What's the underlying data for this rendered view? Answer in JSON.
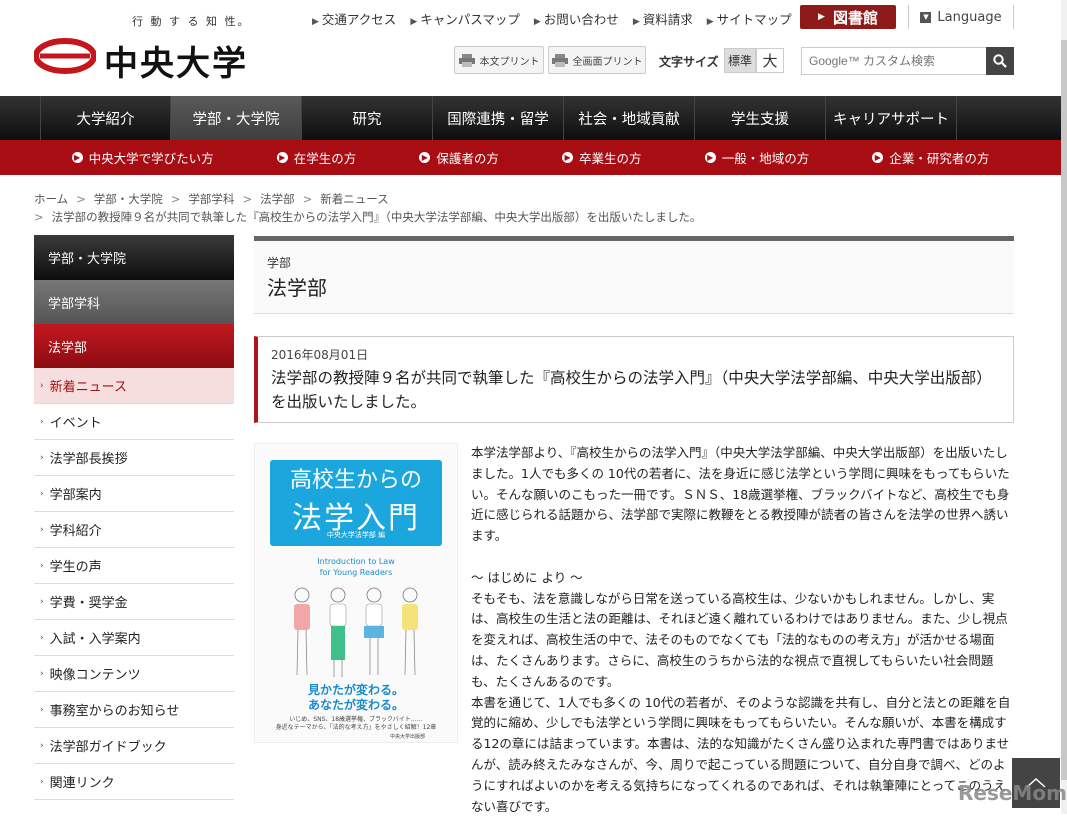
{
  "header": {
    "tagline": "行 動 す る 知 性。",
    "logo_text": "中央大学",
    "top_links": [
      "交通アクセス",
      "キャンパスマップ",
      "お問い合わせ",
      "資料請求",
      "サイトマップ"
    ],
    "library_label": "図書館",
    "language_label": "Language",
    "print_body_label": "本文プリント",
    "print_all_label": "全画面プリント",
    "font_size_label": "文字サイズ",
    "font_size_standard": "標準",
    "font_size_large": "大",
    "search_placeholder": "Google™ カスタム検索"
  },
  "main_nav": [
    "大学紹介",
    "学部・大学院",
    "研究",
    "国際連携・留学",
    "社会・地域貢献",
    "学生支援",
    "キャリアサポート"
  ],
  "main_nav_active": "学部・大学院",
  "sub_nav": [
    "中央大学で学びたい方",
    "在学生の方",
    "保護者の方",
    "卒業生の方",
    "一般・地域の方",
    "企業・研究者の方"
  ],
  "breadcrumb": {
    "items": [
      "ホーム",
      "学部・大学院",
      "学部学科",
      "法学部",
      "新着ニュース"
    ],
    "current": "法学部の教授陣９名が共同で執筆した『高校生からの法学入門』（中央大学法学部編、中央大学出版部）を出版いたしました。"
  },
  "sidebar": {
    "heading1": "学部・大学院",
    "heading2": "学部学科",
    "heading3": "法学部",
    "items": [
      "新着ニュース",
      "イベント",
      "法学部長挨拶",
      "学部案内",
      "学科紹介",
      "学生の声",
      "学費・奨学金",
      "入試・入学案内",
      "映像コンテンツ",
      "事務室からのお知らせ",
      "法学部ガイドブック",
      "関連リンク"
    ]
  },
  "category": {
    "sub": "学部",
    "title": "法学部"
  },
  "news": {
    "date": "2016年08月01日",
    "title": "法学部の教授陣９名が共同で執筆した『高校生からの法学入門』（中央大学法学部編、中央大学出版部）を出版いたしました。"
  },
  "book": {
    "title_line1": "高校生からの",
    "title_line2": "法学入門",
    "editor": "中央大学法学部 編",
    "english_line1": "Introduction to Law",
    "english_line2": "for Young Readers",
    "catch1": "見かたが変わる。",
    "catch2": "あなたが変わる。",
    "note1": "いじめ、SNS、18歳選挙権、ブラックバイト……",
    "note2": "身近なテーマから、「法的な考え方」をやさしく紹解！12章",
    "publisher": "中央大学出版部"
  },
  "body": {
    "p1": "本学法学部より、『高校生からの法学入門』（中央大学法学部編、中央大学出版部）を出版いたしました。1人でも多くの 10代の若者に、法を身近に感じ法学という学問に興味をもってもらいたい。そんな願いのこもった一冊です。ＳＮＳ、18歳選挙権、ブラックバイトなど、高校生でも身近に感じられる話題から、法学部で実際に教鞭をとる教授陣が読者の皆さんを法学の世界へ誘います。",
    "p2_heading": "～ はじめに より ～",
    "p2": "そもそも、法を意識しながら日常を送っている高校生は、少ないかもしれません。しかし、実は、高校生の生活と法の距離は、それほど遠く離れているわけではありません。また、少し視点を変えれば、高校生活の中で、法そのものでなくても「法的なものの考え方」が活かせる場面は、たくさんあります。さらに、高校生のうちから法的な視点で直視してもらいたい社会問題も、たくさんあるのです。",
    "p3": "本書を通じて、1人でも多くの 10代の若者が、そのような認識を共有し、自分と法との距離を自覚的に縮め、少しでも法学という学問に興味をもってもらいたい。そんな願いが、本書を構成する12の章には詰まっています。本書は、法的な知識がたくさん盛り込まれた専門書ではありませんが、読み終えたみなさんが、今、周りで起こっている問題について、自分自身で調べ、どのようにすればよいのかを考える気持ちになってくれるのであれば、それは執筆陣にとってこのうえない喜びです。"
  },
  "watermark": "ReseMom",
  "colors": {
    "brand_red": "#a90d14",
    "nav_dark": "#1a1a1a",
    "book_blue": "#1ba6de"
  }
}
